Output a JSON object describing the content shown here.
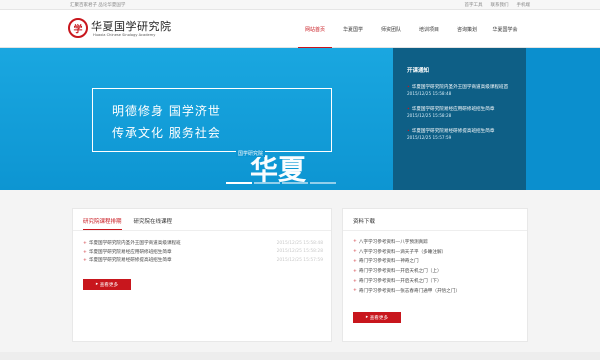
{
  "topbar": {
    "slogan": "汇聚百家君子 品论华夏国学",
    "links": [
      "首字工具",
      "联系我们",
      "手机端"
    ]
  },
  "header": {
    "logo_cn": "华夏国学研究院",
    "logo_en": "Huaxia Chinese Sinology Academy",
    "nav": [
      "网站首页",
      "华夏国学",
      "师资团队",
      "培训项目",
      "咨询策划",
      "华夏国学会"
    ]
  },
  "banner": {
    "slogan_line1": "明德修身  国学济世",
    "slogan_line2": "传承文化  服务社会",
    "brand_mark": "华夏",
    "tag": "国学研究院",
    "notice_title": "开课通知",
    "notices": [
      {
        "text": "华夏国学研究院内圣外王国学商道高级课程班首",
        "date": "2015/12/25 15:58:48"
      },
      {
        "text": "华夏国学研究院易经应用研修班招生简章",
        "date": "2015/12/25 15:58:28"
      },
      {
        "text": "华夏国学研究院易经研修提高班招生简章",
        "date": "2015/12/25 15:57:59"
      }
    ]
  },
  "left_panel": {
    "tabs": [
      "研究院课程排期",
      "研究院在线课程"
    ],
    "rows": [
      {
        "text": "华夏国学研究院内圣外王国学商道高级课程班",
        "date": "2015/12/25 15:58:48"
      },
      {
        "text": "华夏国学研究院易经应用研修班招生简章",
        "date": "2015/12/25 15:58:28"
      },
      {
        "text": "华夏国学研究院易经研修提高班招生简章",
        "date": "2015/12/25 15:57:59"
      }
    ],
    "more": "查看更多"
  },
  "right_panel": {
    "title": "资料下载",
    "rows": [
      "八字学习参考资料—八字预测真踪",
      "八字学习参考资料—滴天子平（多睡注解）",
      "奇门学习参考资料—神奇之门",
      "奇门学习参考资料—开启天机之门（上）",
      "奇门学习参考资料—开启天机之门（下）",
      "奇门学习参考资料—张志春奇门通甲（开悟之门）"
    ],
    "more": "查看更多"
  },
  "colors": {
    "brand_red": "#c8161d",
    "banner_blue": "#0d95d2",
    "notice_bg": "#0e5f86"
  }
}
